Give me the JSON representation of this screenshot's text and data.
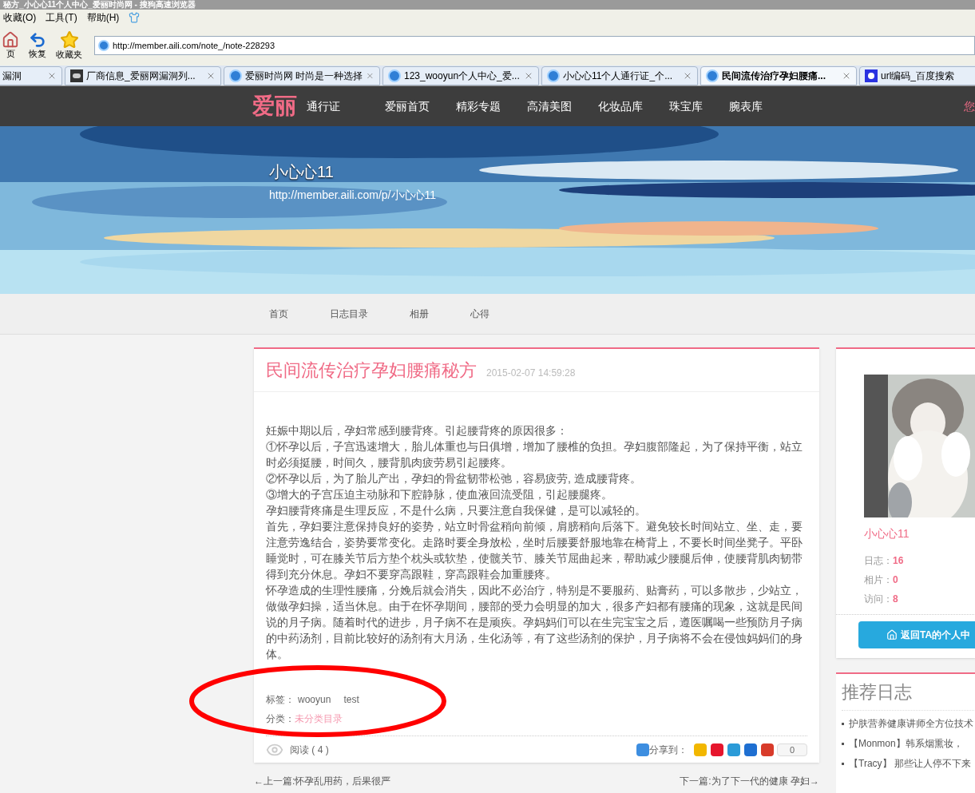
{
  "window": {
    "title": "秘方_小心心11个人中心_爱丽时尚网 - 搜狗高速浏览器"
  },
  "menu": [
    "收藏(O)",
    "工具(T)",
    "帮助(H)"
  ],
  "toolbar": [
    {
      "kind": "home",
      "label": "页"
    },
    {
      "kind": "undo",
      "label": "恢复"
    },
    {
      "kind": "star",
      "label": "收藏夹"
    }
  ],
  "address": {
    "value": "http://member.aili.com/note_/note-228293"
  },
  "tabs": [
    {
      "label": "漏洞",
      "kind": "plain",
      "selected": false
    },
    {
      "label": "厂商信息_爱丽网漏洞列...",
      "kind": "cloud",
      "selected": false
    },
    {
      "label": "爱丽时尚网 时尚是一种选择",
      "kind": "browser",
      "selected": false
    },
    {
      "label": "123_wooyun个人中心_爱...",
      "kind": "browser",
      "selected": false
    },
    {
      "label": "小心心11个人通行证_个...",
      "kind": "browser",
      "selected": false
    },
    {
      "label": "民间流传治疗孕妇腰痛...",
      "kind": "browser",
      "selected": true
    },
    {
      "label": "url编码_百度搜索",
      "kind": "paw",
      "selected": false
    }
  ],
  "site_nav": {
    "logo": "爱丽",
    "passport": "通行证",
    "links": [
      "爱丽首页",
      "精彩专题",
      "高清美图",
      "化妆品库",
      "珠宝库",
      "腕表库"
    ],
    "greeting": "您"
  },
  "banner": {
    "name": "小心心11",
    "url": "http://member.aili.com/p/小心心11"
  },
  "sub_nav": [
    "首页",
    "日志目录",
    "相册",
    "心得"
  ],
  "article": {
    "title": "民间流传治疗孕妇腰痛秘方",
    "date": "2015-02-07 14:59:28",
    "paragraphs": [
      "妊娠中期以后，孕妇常感到腰背疼。引起腰背疼的原因很多：",
      "①怀孕以后，子宫迅速增大，胎儿体重也与日俱增，增加了腰椎的负担。孕妇腹部隆起，为了保持平衡，站立时必须挺腰，时间久，腰背肌肉疲劳易引起腰疼。",
      "②怀孕以后，为了胎儿产出，孕妇的骨盆韧带松弛，容易疲劳, 造成腰背疼。",
      "③增大的子宫压迫主动脉和下腔静脉，使血液回流受阻，引起腰腿疼。",
      "孕妇腰背疼痛是生理反应，不是什么病，只要注意自我保健，是可以减轻的。",
      "首先，孕妇要注意保持良好的姿势，站立时骨盆稍向前倾，肩膀稍向后落下。避免较长时间站立、坐、走，要注意劳逸结合，姿势要常变化。走路时要全身放松，坐时后腰要舒服地靠在椅背上，不要长时间坐凳子。平卧睡觉时，可在膝关节后方垫个枕头或软垫，使髋关节、膝关节屈曲起来，帮助减少腰腿后伸，使腰背肌肉韧带得到充分休息。孕妇不要穿高跟鞋，穿高跟鞋会加重腰疼。",
      "怀孕造成的生理性腰痛，分娩后就会消失，因此不必治疗，特别是不要服药、贴膏药，可以多散步，少站立，做做孕妇操，适当休息。由于在怀孕期间，腰部的受力会明显的加大，很多产妇都有腰痛的现象，这就是民间说的月子病。随着时代的进步，月子病不在是顽疾。孕妈妈们可以在生完宝宝之后，遵医嘱喝一些预防月子病的中药汤剂，目前比较好的汤剂有大月汤，生化汤等，有了这些汤剂的保护，月子病将不会在侵蚀妈妈们的身体。"
    ],
    "tags_label": "标签：",
    "tags": [
      "wooyun",
      "test"
    ],
    "category_label": "分类：",
    "category": "未分类目录",
    "reads": "阅读 ( 4 )",
    "share_label": "分享到：",
    "share_icons": [
      {
        "color": "#f2b700"
      },
      {
        "color": "#e6162d"
      },
      {
        "color": "#2b9bd8"
      },
      {
        "color": "#1e6fd1"
      },
      {
        "color": "#d83b2a"
      }
    ],
    "share_count": "0",
    "prev": "←上一篇:怀孕乱用药，后果很严",
    "next": "下一篇:为了下一代的健康 孕妇→"
  },
  "profile": {
    "name": "小心心11",
    "stats": [
      {
        "label": "日志：",
        "value": "16"
      },
      {
        "label": "相片：",
        "value": "0"
      },
      {
        "label": "访问：",
        "value": "8"
      }
    ],
    "button": "返回TA的个人中"
  },
  "recommended": {
    "title": "推荐日志",
    "items": [
      "护肤营养健康讲师全方位技术",
      "【Monmon】韩系烟熏妆，",
      "【Tracy】 那些让人停不下来"
    ]
  }
}
